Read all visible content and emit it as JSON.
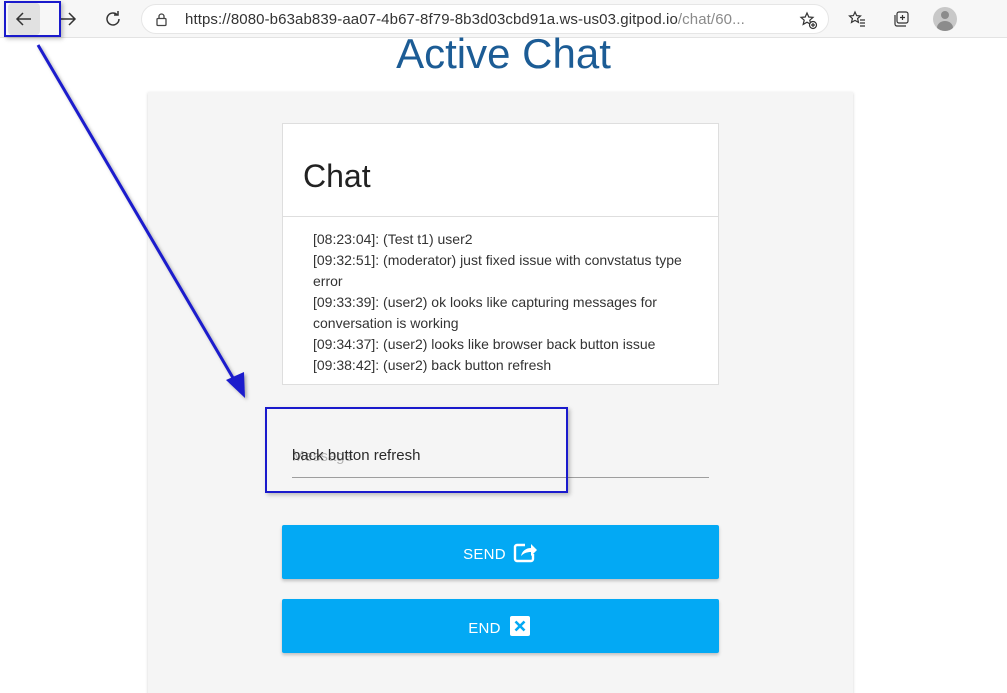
{
  "browser": {
    "url_main": "https://8080-b63ab839-aa07-4b67-8f79-8b3d03cbd91a.ws-us03.gitpod.io",
    "url_path": "/chat/60...",
    "icons": [
      "back-icon",
      "forward-icon",
      "reload-icon",
      "lock-icon",
      "add-favorite-icon",
      "favorites-icon",
      "collections-icon",
      "profile-icon"
    ]
  },
  "page": {
    "title": "Active Chat"
  },
  "chat": {
    "title": "Chat",
    "messages": [
      "[08:23:04]: (Test t1) user2",
      "[09:32:51]: (moderator) just fixed issue with convstatus type error",
      "[09:33:39]: (user2) ok looks like capturing messages for conversation is working",
      "[09:34:37]: (user2) looks like browser back button issue",
      "[09:38:42]: (user2) back button refresh"
    ]
  },
  "composer": {
    "placeholder": "Message",
    "value": "back button refresh"
  },
  "buttons": {
    "send_label": "SEND",
    "end_label": "END"
  },
  "colors": {
    "title": "#1c5c95",
    "button": "#03a9f4",
    "annotation": "#1a1acc"
  }
}
